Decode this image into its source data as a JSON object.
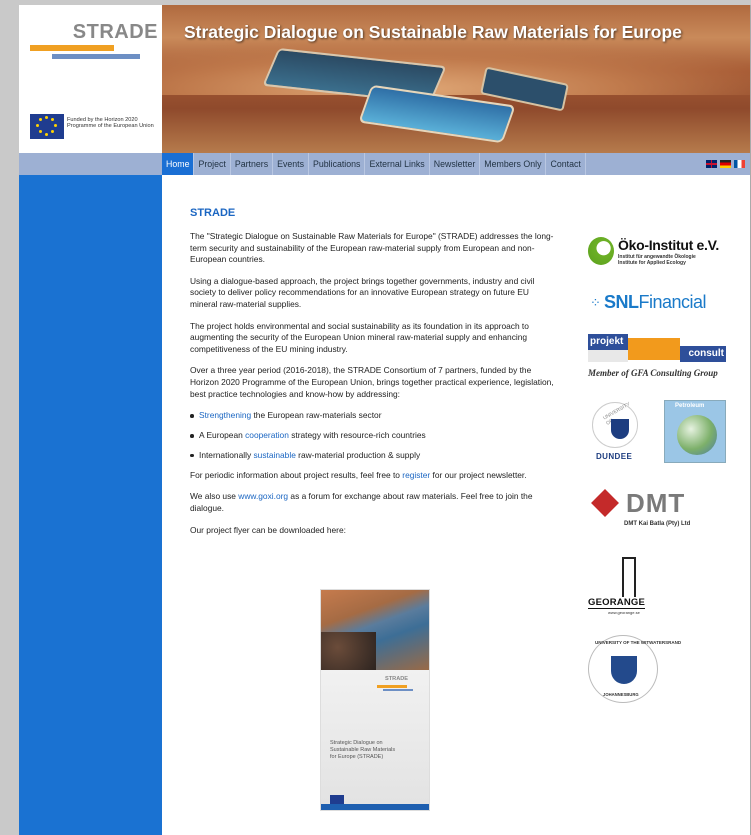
{
  "header": {
    "logo_text": "STRADE",
    "funded_text": "Funded by the Horizon 2020 Programme of the European Union",
    "banner_title": "Strategic Dialogue on Sustainable Raw Materials for Europe"
  },
  "nav": {
    "items": [
      "Home",
      "Project",
      "Partners",
      "Events",
      "Publications",
      "External Links",
      "Newsletter",
      "Members Only",
      "Contact"
    ],
    "active": "Home",
    "languages": [
      "en-flag-icon",
      "de-flag-icon",
      "fr-flag-icon"
    ]
  },
  "content": {
    "title": "STRADE",
    "p1": "The \"Strategic Dialogue on Sustainable Raw Materials for Europe\" (STRADE) addresses the long-term security and sustainability of the European raw-material supply from European and non-European countries.",
    "p2": "Using a dialogue-based approach, the project brings together governments, industry and civil society to deliver policy recommendations for an innovative European strategy on future EU mineral raw-material supplies.",
    "p3": "The project holds environmental and social sustainability as its foundation in its approach to augmenting the security of the European Union mineral raw-material supply and enhancing competitiveness of the EU mining industry.",
    "p4": "Over a three year period (2016-2018), the STRADE Consortium of 7 partners, funded by the Horizon 2020 Programme of the European Union, brings together practical experience, legislation, best practice technologies and know-how by addressing:",
    "bullets": [
      {
        "link": "Strengthening",
        "rest": " the European raw-materials sector"
      },
      {
        "pre": "A European ",
        "link": "cooperation",
        "rest": " strategy with resource-rich countries"
      },
      {
        "pre": "Internationally ",
        "link": "sustainable",
        "rest": " raw-material production & supply"
      }
    ],
    "p5_pre": "For periodic information about project results, feel free to ",
    "p5_link": "register",
    "p5_post": " for our project newsletter.",
    "p6_pre": "We also use ",
    "p6_link": "www.goxi.org",
    "p6_post": " as a forum for exchange about raw materials. Feel free to join the dialogue.",
    "p7": "Our project flyer can be downloaded here:"
  },
  "flyer": {
    "logo": "STRADE",
    "text": "Strategic Dialogue on Sustainable Raw Materials for Europe (STRADE)"
  },
  "partners": {
    "oeko_name": "Öko-Institut e.V.",
    "oeko_sub1": "Institut für angewandte Ökologie",
    "oeko_sub2": "Institute for Applied Ecology",
    "snl_a": "SNL",
    "snl_b": "Financial",
    "projekt_a": "projekt",
    "projekt_b": "consult",
    "projekt_caption": "Member of GFA Consulting Group",
    "dundee_arc": "UNIVERSITY OF",
    "dundee_name": "DUNDEE",
    "petro_title": "Petroleum",
    "dmt_name": "DMT",
    "dmt_sub": "DMT Kai Batla (Pty) Ltd",
    "georange_name": "GEORANGE",
    "georange_url": "www.georange.se",
    "wits_top": "UNIVERSITY OF THE WITWATERSRAND",
    "wits_bottom": "JOHANNESBURG"
  },
  "colors": {
    "nav_bg": "#9db0d3",
    "nav_active": "#1a6fd4",
    "sidebar": "#1a72d2",
    "link": "#1b66c2"
  }
}
